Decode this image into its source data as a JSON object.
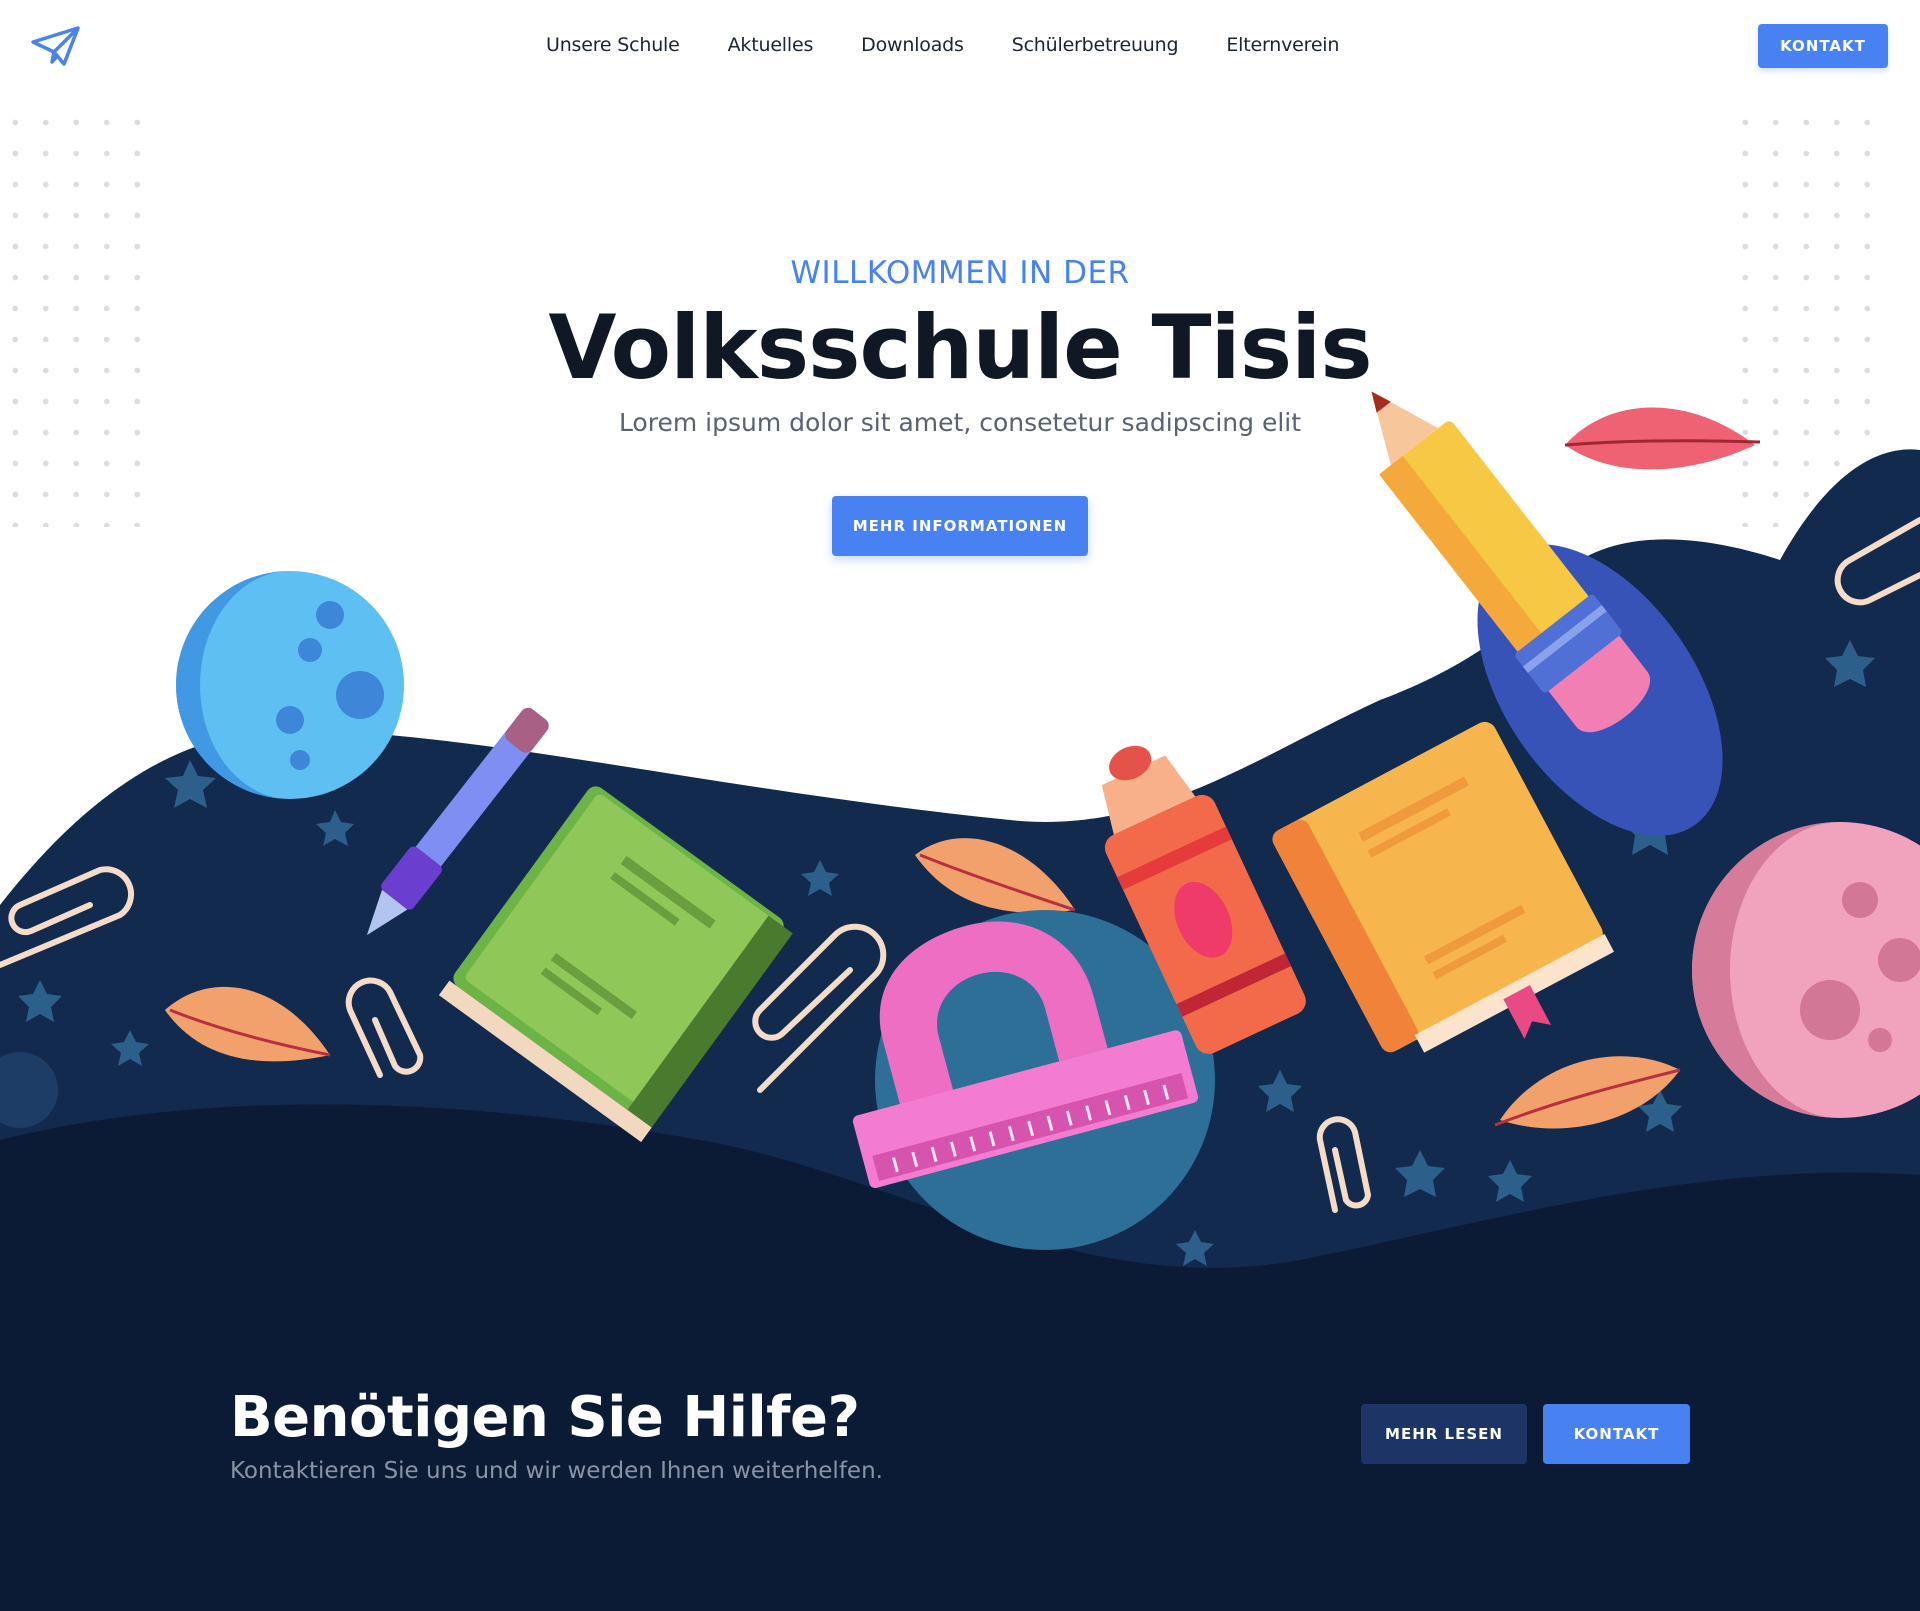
{
  "header": {
    "logo_icon": "paper-plane-icon",
    "nav": [
      {
        "label": "Unsere Schule"
      },
      {
        "label": "Aktuelles"
      },
      {
        "label": "Downloads"
      },
      {
        "label": "Schülerbetreuung"
      },
      {
        "label": "Elternverein"
      }
    ],
    "contact_label": "KONTAKT"
  },
  "hero": {
    "eyebrow": "WILLKOMMEN IN DER",
    "title": "Volksschule Tisis",
    "subtitle": "Lorem ipsum dolor sit amet, consetetur sadipscing elit",
    "cta_label": "MEHR INFORMATIONEN"
  },
  "cta": {
    "title": "Benötigen Sie Hilfe?",
    "subtitle": "Kontaktieren Sie uns und wir werden Ihnen weiterhelfen.",
    "read_more_label": "MEHR LESEN",
    "contact_label": "KONTAKT"
  },
  "colors": {
    "accent": "#4781f2",
    "dark_navy": "#0b1b36",
    "wave_navy": "#132a4f",
    "heading": "#101826"
  }
}
